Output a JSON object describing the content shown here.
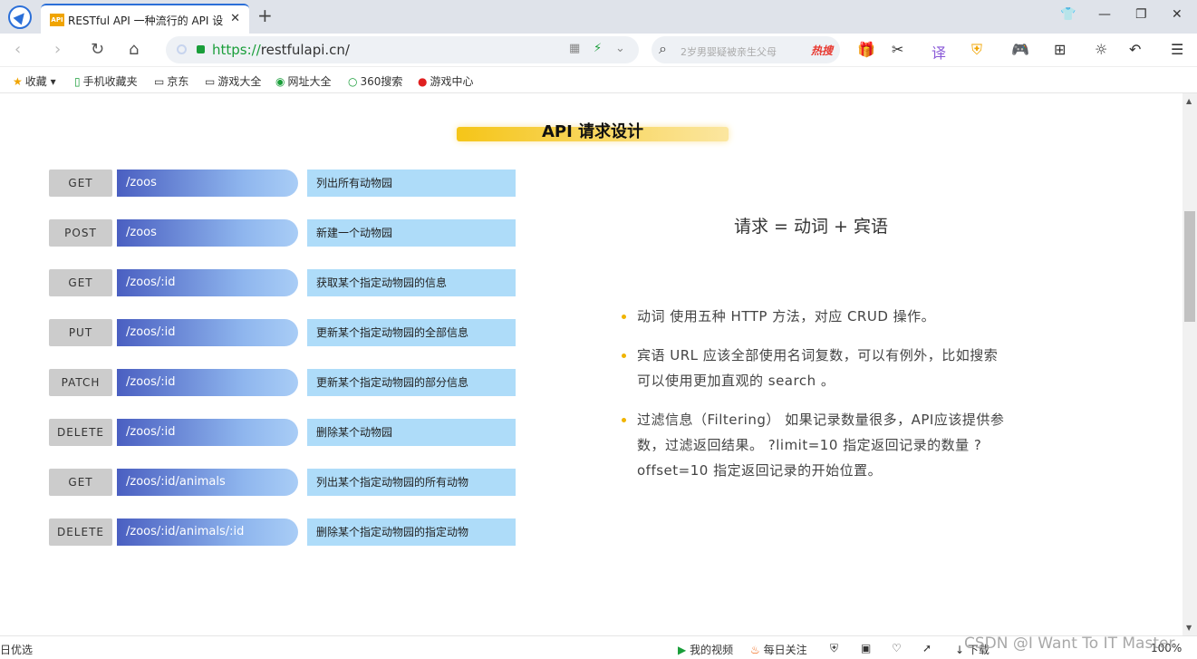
{
  "browser": {
    "tab_title": "RESTful API 一种流行的 API 设",
    "tab_favicon": "API",
    "url_scheme": "https://",
    "url_rest": "restfulapi.cn/",
    "search_placeholder": "2岁男婴疑被亲生父母",
    "search_hot": "热搜"
  },
  "bookmarks": [
    {
      "label": "收藏",
      "icon": "star-icon"
    },
    {
      "label": "手机收藏夹",
      "icon": "phone-icon"
    },
    {
      "label": "京东",
      "icon": "page-icon"
    },
    {
      "label": "游戏大全",
      "icon": "page-icon"
    },
    {
      "label": "网址大全",
      "icon": "compass-icon"
    },
    {
      "label": "360搜索",
      "icon": "search-360-icon"
    },
    {
      "label": "游戏中心",
      "icon": "game-icon"
    }
  ],
  "page": {
    "heading": "API 请求设计",
    "formula": "请求 = 动词 + 宾语",
    "routes": [
      {
        "method": "GET",
        "path": "/zoos",
        "desc": "列出所有动物园"
      },
      {
        "method": "POST",
        "path": "/zoos",
        "desc": "新建一个动物园"
      },
      {
        "method": "GET",
        "path": "/zoos/:id",
        "desc": "获取某个指定动物园的信息"
      },
      {
        "method": "PUT",
        "path": "/zoos/:id",
        "desc": "更新某个指定动物园的全部信息"
      },
      {
        "method": "PATCH",
        "path": "/zoos/:id",
        "desc": "更新某个指定动物园的部分信息"
      },
      {
        "method": "DELETE",
        "path": "/zoos/:id",
        "desc": "删除某个动物园"
      },
      {
        "method": "GET",
        "path": "/zoos/:id/animals",
        "desc": "列出某个指定动物园的所有动物"
      },
      {
        "method": "DELETE",
        "path": "/zoos/:id/animals/:id",
        "desc": "删除某个指定动物园的指定动物"
      }
    ],
    "bullets": [
      "动词 使用五种 HTTP 方法，对应 CRUD 操作。",
      "宾语 URL 应该全部使用名词复数，可以有例外，比如搜索可以使用更加直观的 search 。",
      "过滤信息（Filtering） 如果记录数量很多，API应该提供参数，过滤返回结果。 ?limit=10 指定返回记录的数量 ?offset=10 指定返回记录的开始位置。"
    ]
  },
  "status": {
    "left": "日优选",
    "video": "我的视频",
    "follow": "每日关注",
    "download": "下载",
    "zoom": "100%"
  },
  "watermark": "CSDN @I Want To IT Master",
  "colors": {
    "accent": "#2b6fd8",
    "heading_bar": "#f5c518",
    "bullet": "#f0b400",
    "desc_bg": "#aedcf9"
  }
}
